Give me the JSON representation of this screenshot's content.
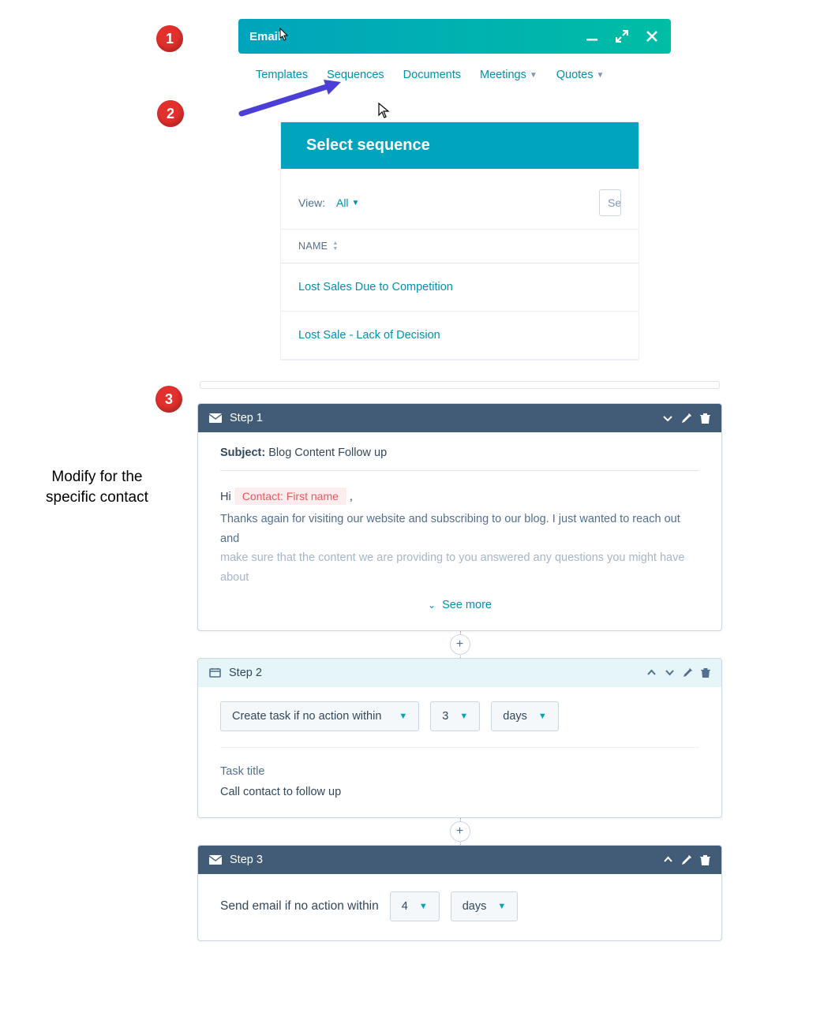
{
  "badges": {
    "one": "1",
    "two": "2",
    "three": "3"
  },
  "emailHeader": {
    "title": "Email"
  },
  "tabs": {
    "templates": "Templates",
    "sequences": "Sequences",
    "documents": "Documents",
    "meetings": "Meetings",
    "quotes": "Quotes"
  },
  "selectSequence": {
    "title": "Select sequence",
    "viewLabel": "View:",
    "viewValue": "All",
    "searchPlaceholder": "Se",
    "colName": "NAME",
    "rows": {
      "r1": "Lost Sales Due to Competition",
      "r2": "Lost Sale - Lack of Decision"
    }
  },
  "note": {
    "line1": "Modify for the",
    "line2": "specific contact"
  },
  "step1": {
    "title": "Step 1",
    "subjectLabel": "Subject:",
    "subjectValue": "Blog Content Follow up",
    "greetPrefix": "Hi ",
    "token": "Contact: First name",
    "greetSuffix": " ,",
    "para1": "Thanks again for visiting our website and subscribing to our blog.  I just wanted to reach out and",
    "para2": "make sure that the content we are providing to you answered any questions you might have about",
    "seeMore": "See more"
  },
  "step2": {
    "title": "Step 2",
    "trigger": "Create task if no action within",
    "number": "3",
    "unit": "days",
    "taskTitleLabel": "Task title",
    "taskTitleValue": "Call contact to follow up"
  },
  "step3": {
    "title": "Step 3",
    "label": "Send email if no action within",
    "number": "4",
    "unit": "days"
  }
}
